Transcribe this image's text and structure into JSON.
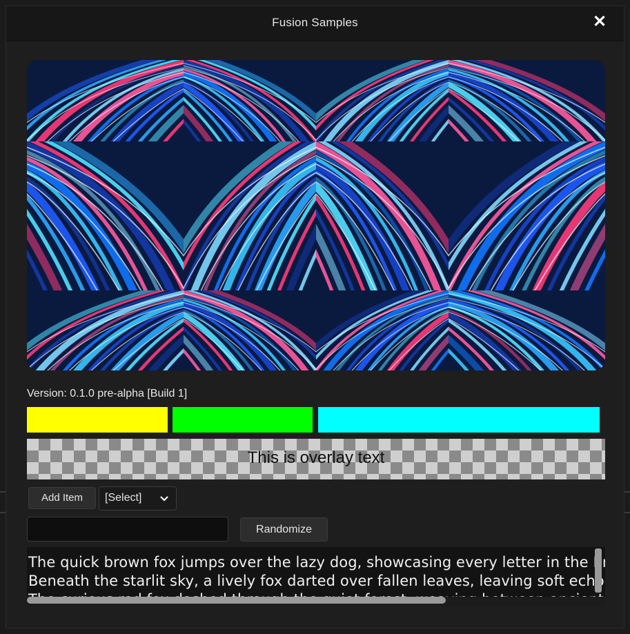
{
  "window": {
    "title": "Fusion Samples",
    "close_icon": "close-icon"
  },
  "image_panel": {
    "description_icon": "light-streaks-image",
    "tiles_cols": 4,
    "tiles_rows": 3
  },
  "version_label": "Version: 0.1.0 pre-alpha [Build 1]",
  "color_bars": [
    {
      "name": "yellow",
      "color": "#ffff00"
    },
    {
      "name": "green",
      "color": "#00ff00"
    },
    {
      "name": "cyan",
      "color": "#00ffff"
    }
  ],
  "overlay": {
    "text": "This is overlay text"
  },
  "controls": {
    "add_item_label": "Add Item",
    "select_value": "[Select]",
    "text_input_value": "",
    "randomize_label": "Randomize"
  },
  "text_area": {
    "lines": [
      "The quick brown fox jumps over the lazy dog, showcasing every letter in the English alphabet.",
      "Beneath the starlit sky, a lively fox darted over fallen leaves, leaving soft echoes behind.",
      "The curious red fox dashed through the quiet forest, weaving between ancient trees."
    ]
  },
  "colors": {
    "background": "#1e1e1e",
    "titlebar": "#171717",
    "accent_blue": "#1f6dff",
    "accent_pink": "#ff2d6a"
  }
}
